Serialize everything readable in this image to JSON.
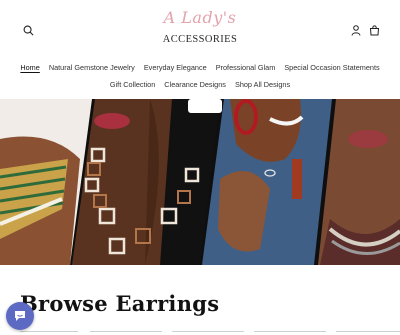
{
  "header": {
    "logo": {
      "line1": "A Lady's",
      "line2": "ACCESSORIES"
    },
    "icons": {
      "search": "search-icon",
      "account": "account-icon",
      "cart": "cart-icon"
    }
  },
  "nav": {
    "items": [
      {
        "label": "Home",
        "active": true
      },
      {
        "label": "Natural Gemstone Jewelry"
      },
      {
        "label": "Everyday Elegance"
      },
      {
        "label": "Professional Glam"
      },
      {
        "label": "Special Occasion Statements"
      },
      {
        "label": "Gift Collection"
      },
      {
        "label": "Clearance Designs"
      },
      {
        "label": "Shop All Designs"
      }
    ]
  },
  "section": {
    "title": "Browse Earrings"
  },
  "chat": {
    "icon": "chat-icon"
  },
  "colors": {
    "logo_pink": "#e2a3ad",
    "chat_purple": "#5c6ac4"
  }
}
